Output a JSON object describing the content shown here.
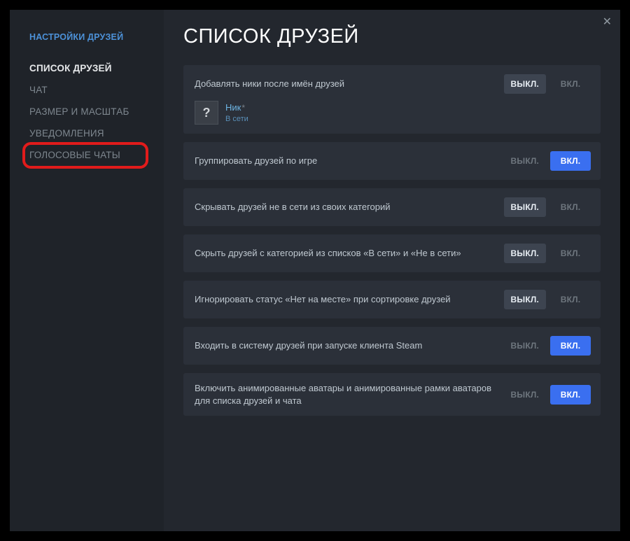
{
  "sidebar": {
    "header": "НАСТРОЙКИ ДРУЗЕЙ",
    "items": [
      {
        "label": "СПИСОК ДРУЗЕЙ",
        "active": true
      },
      {
        "label": "ЧАТ"
      },
      {
        "label": "РАЗМЕР И МАСШТАБ"
      },
      {
        "label": "УВЕДОМЛЕНИЯ"
      },
      {
        "label": "ГОЛОСОВЫЕ ЧАТЫ",
        "highlighted": true
      }
    ]
  },
  "page": {
    "title": "СПИСОК ДРУЗЕЙ"
  },
  "labels": {
    "off": "ВЫКЛ.",
    "on": "ВКЛ."
  },
  "nick_preview": {
    "avatar_glyph": "?",
    "name": "Ник",
    "star": "*",
    "status": "В сети"
  },
  "settings": [
    {
      "label": "Добавлять ники после имён друзей",
      "value": "off",
      "has_preview": true
    },
    {
      "label": "Группировать друзей по игре",
      "value": "on"
    },
    {
      "label": "Скрывать друзей не в сети из своих категорий",
      "value": "off"
    },
    {
      "label": "Скрыть друзей с категорией из списков «В сети» и «Не в сети»",
      "value": "off"
    },
    {
      "label": "Игнорировать статус «Нет на месте» при сортировке друзей",
      "value": "off"
    },
    {
      "label": "Входить в систему друзей при запуске клиента Steam",
      "value": "on"
    },
    {
      "label": "Включить анимированные аватары и анимированные рамки аватаров для списка друзей и чата",
      "value": "on"
    }
  ]
}
